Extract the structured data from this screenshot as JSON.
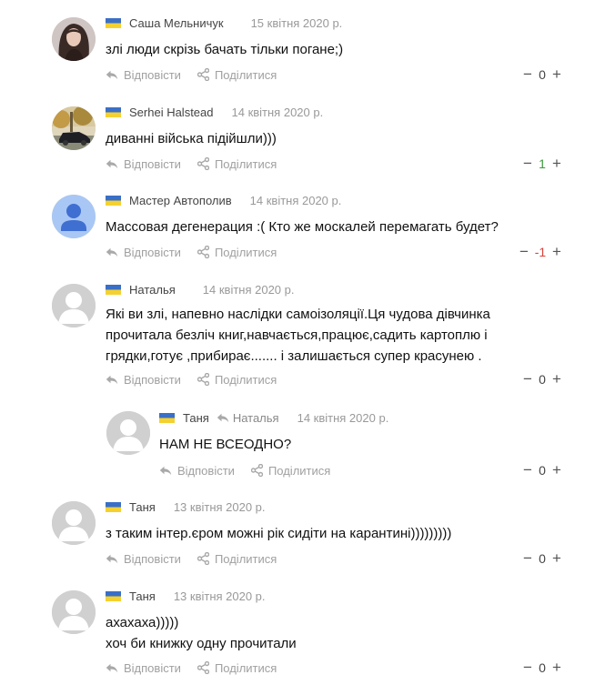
{
  "comments": [
    {
      "author": "Саша Мельничук",
      "date": "15 квітня 2020 р.",
      "text": "злі люди скрізь бачать тільки погане;)",
      "reply_label": "Відповісти",
      "share_label": "Поділитися",
      "score": "0",
      "score_color": "#555555",
      "avatar": "photo-woman"
    },
    {
      "author": "Serhei Halstead",
      "date": "14 квітня 2020 р.",
      "text": "диванні війська підійшли)))",
      "reply_label": "Відповісти",
      "share_label": "Поділитися",
      "score": "1",
      "score_color": "#3c9a3c",
      "avatar": "photo-car"
    },
    {
      "author": "Мастер Автополив",
      "date": "14 квітня 2020 р.",
      "text": "Массовая дегенерация :( Кто же москалей перемагать будет?",
      "reply_label": "Відповісти",
      "share_label": "Поділитися",
      "score": "-1",
      "score_color": "#d8413a",
      "avatar": "default-blue"
    },
    {
      "author": "Наталья",
      "date": "14 квітня 2020 р.",
      "text": "Які ви злі, напевно наслідки самоізоляції.Ця чудова дівчинка прочитала безліч книг,навчається,працює,садить картоплю і грядки,готує ,прибирає....... і залишається супер красунею .",
      "reply_label": "Відповісти",
      "share_label": "Поділитися",
      "score": "0",
      "score_color": "#555555",
      "avatar": "default-gray"
    },
    {
      "author": "Таня",
      "reply_to": "Наталья",
      "date": "14 квітня 2020 р.",
      "text": "НАМ НЕ ВСЕОДНО?",
      "reply_label": "Відповісти",
      "share_label": "Поділитися",
      "score": "0",
      "score_color": "#555555",
      "avatar": "default-gray"
    },
    {
      "author": "Таня",
      "date": "13 квітня 2020 р.",
      "text": "з таким інтер.єром можні рік сидіти на карантині)))))))))",
      "reply_label": "Відповісти",
      "share_label": "Поділитися",
      "score": "0",
      "score_color": "#555555",
      "avatar": "default-gray"
    },
    {
      "author": "Таня",
      "date": "13 квітня 2020 р.",
      "text_lines": [
        "ахахаха)))))",
        "хоч би книжку одну прочитали"
      ],
      "reply_label": "Відповісти",
      "share_label": "Поділитися",
      "score": "0",
      "score_color": "#555555",
      "avatar": "default-gray"
    }
  ],
  "icons": {
    "flag": "ukraine-flag-icon",
    "reply": "reply-arrow-icon",
    "share": "share-icon",
    "minus": "minus-icon",
    "plus": "plus-icon"
  },
  "colors": {
    "flag_blue": "#3a6fc7",
    "flag_yellow": "#f5d130",
    "meta_gray": "#999999",
    "action_gray": "#a0a0a0",
    "positive": "#3c9a3c",
    "negative": "#d8413a"
  }
}
